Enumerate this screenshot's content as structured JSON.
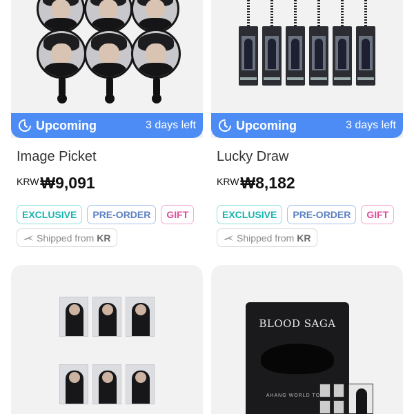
{
  "products": [
    {
      "status": "Upcoming",
      "time_left": "3 days left",
      "title": "Image Picket",
      "currency": "KRW",
      "price": "₩9,091",
      "tags": [
        "EXCLUSIVE",
        "PRE-ORDER",
        "GIFT"
      ],
      "shipping": {
        "label": "Shipped from",
        "origin": "KR"
      }
    },
    {
      "status": "Upcoming",
      "time_left": "3 days left",
      "title": "Lucky Draw",
      "currency": "KRW",
      "price": "₩8,182",
      "tags": [
        "EXCLUSIVE",
        "PRE-ORDER",
        "GIFT"
      ],
      "shipping": {
        "label": "Shipped from",
        "origin": "KR"
      }
    }
  ],
  "lower_products": [
    {
      "image_text": ""
    },
    {
      "brand_text": "BLOOD SAGA",
      "sub_text": "AHANG WORLD TOUR"
    }
  ],
  "colors": {
    "status_bar": "#4d8cf5",
    "exclusive": "#16b3ad",
    "preorder": "#5a7fc0",
    "gift": "#e04a9b"
  },
  "icons": {
    "status": "clock-countdown-icon",
    "shipping": "airplane-icon"
  }
}
